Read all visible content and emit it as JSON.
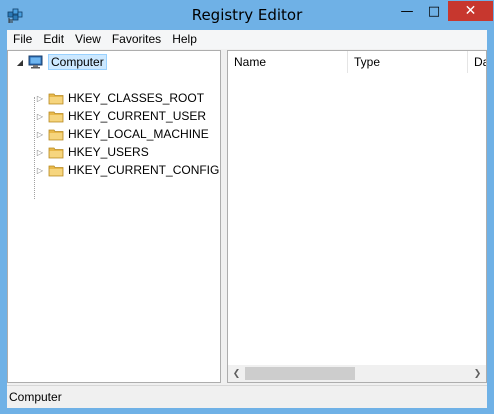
{
  "window": {
    "title": "Registry Editor",
    "app_icon": "registry-editor-icon",
    "controls": {
      "minimize": "—",
      "maximize": "□",
      "close": "✕"
    },
    "close_color": "#c7372e",
    "frame_color": "#6fb1e6"
  },
  "menu": {
    "items": [
      "File",
      "Edit",
      "View",
      "Favorites",
      "Help"
    ]
  },
  "tree": {
    "root": {
      "label": "Computer",
      "icon": "computer-icon",
      "expanded": true,
      "selected": true
    },
    "children": [
      {
        "label": "HKEY_CLASSES_ROOT",
        "icon": "folder-icon"
      },
      {
        "label": "HKEY_CURRENT_USER",
        "icon": "folder-icon"
      },
      {
        "label": "HKEY_LOCAL_MACHINE",
        "icon": "folder-icon"
      },
      {
        "label": "HKEY_USERS",
        "icon": "folder-icon"
      },
      {
        "label": "HKEY_CURRENT_CONFIG",
        "icon": "folder-icon"
      }
    ]
  },
  "list": {
    "columns": [
      "Name",
      "Type",
      "Da"
    ]
  },
  "status": {
    "text": "Computer"
  }
}
